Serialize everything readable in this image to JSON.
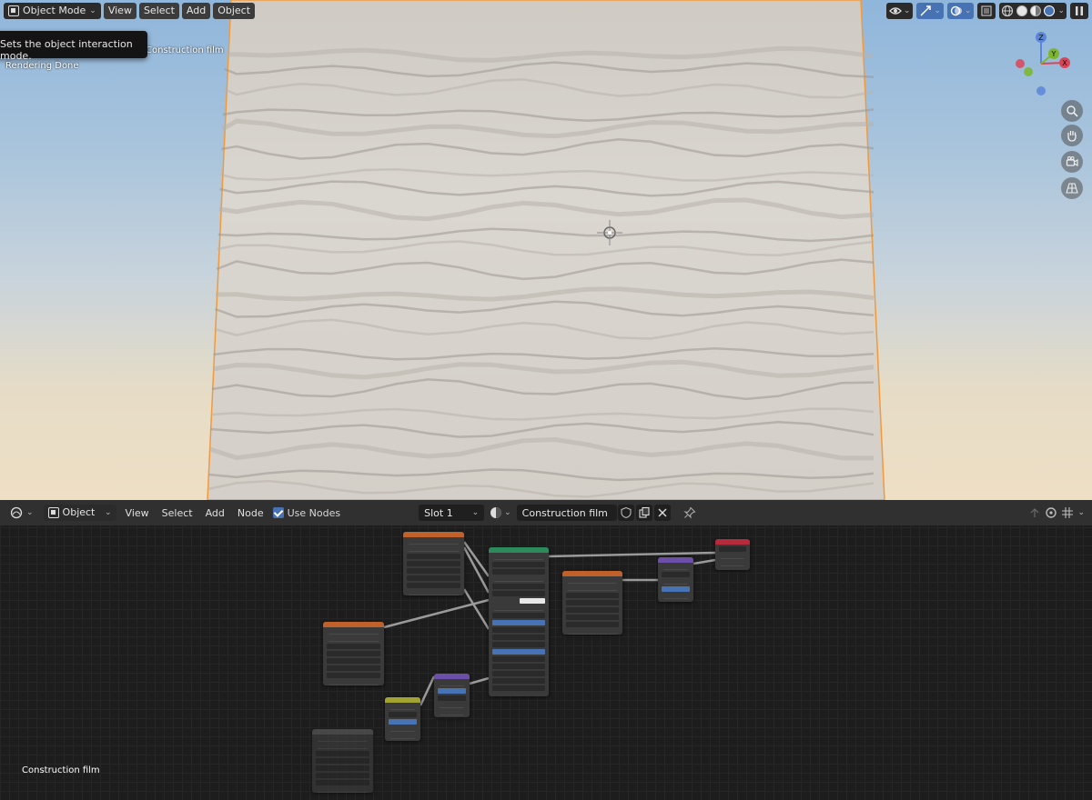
{
  "viewport": {
    "mode_label": "Object Mode",
    "menus": [
      "View",
      "Select",
      "Add",
      "Object"
    ],
    "tooltip": "Sets the object interaction mode.",
    "object_info": "Construction film",
    "status": "Rendering Done",
    "gizmo_axes": {
      "x": "X",
      "y": "Y",
      "z": "Z"
    }
  },
  "node_editor": {
    "editor_type_label": "Object",
    "menus": [
      "View",
      "Select",
      "Add",
      "Node"
    ],
    "use_nodes_label": "Use Nodes",
    "use_nodes_checked": true,
    "slot_label": "Slot 1",
    "material_name": "Construction film",
    "material_label": "Construction film"
  },
  "colors": {
    "accent": "#4772b3",
    "image_node_header": "#c0602a",
    "bsdf_header": "#2d8a5a",
    "output_header": "#b52b3b",
    "vector_node_header": "#6b4fa8",
    "mix_header": "#a3a332",
    "active_outline": "#f29a3a"
  },
  "icons": {
    "mode": "object-mode-icon",
    "visibility": "eye-icon",
    "gizmo": "gizmo-toggle-icon",
    "overlay": "overlay-icon",
    "xray": "xray-icon",
    "zoom": "zoom-icon",
    "pan": "hand-icon",
    "camera": "camera-icon",
    "perspective": "grid-icon",
    "material": "material-sphere-icon",
    "pin": "pin-icon"
  }
}
